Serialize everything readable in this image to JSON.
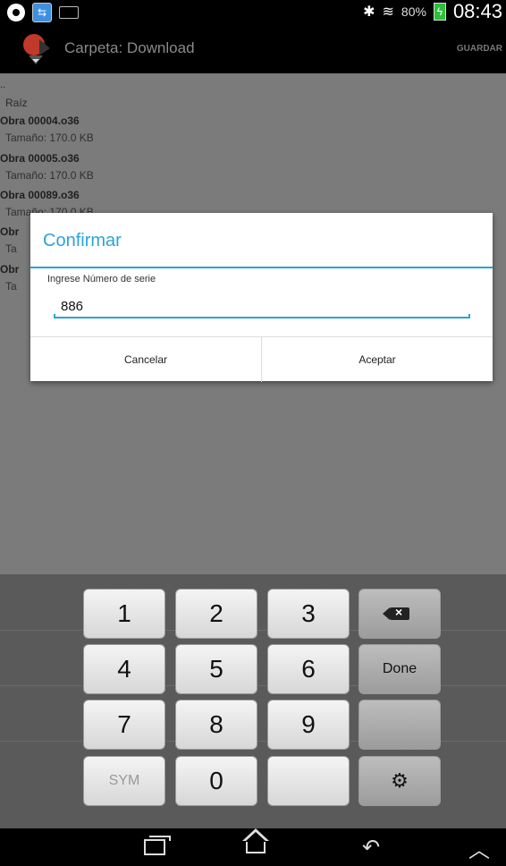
{
  "status_bar": {
    "battery_percent": "80%",
    "time": "08:43",
    "icons": [
      "eye-icon",
      "sync-icon",
      "keyboard-icon",
      "bluetooth-icon",
      "wifi-icon",
      "battery-charging-icon"
    ]
  },
  "action_bar": {
    "title": "Carpeta: Download",
    "save_label": "GUARDAR"
  },
  "file_list": {
    "parent": "..",
    "root_label": "Raíz",
    "files": [
      {
        "name": "Obra 00004.o36",
        "size": "Tamaño: 170.0 KB"
      },
      {
        "name": "Obra 00005.o36",
        "size": "Tamaño: 170.0 KB"
      },
      {
        "name": "Obra 00089.o36",
        "size": "Tamaño: 170.0 KB"
      },
      {
        "name": "Obr",
        "size": "Ta"
      },
      {
        "name": "Obr",
        "size": "Ta"
      }
    ]
  },
  "dialog": {
    "title": "Confirmar",
    "field_label": "Ingrese Número de serie",
    "serial_value": "886",
    "cancel_label": "Cancelar",
    "accept_label": "Aceptar"
  },
  "keyboard": {
    "keys": [
      "1",
      "2",
      "3",
      "4",
      "5",
      "6",
      "7",
      "8",
      "9",
      "0"
    ],
    "sym_label": "SYM",
    "done_label": "Done"
  },
  "colors": {
    "accent": "#2aa4d8",
    "dim_background": "#7b7b7b"
  }
}
